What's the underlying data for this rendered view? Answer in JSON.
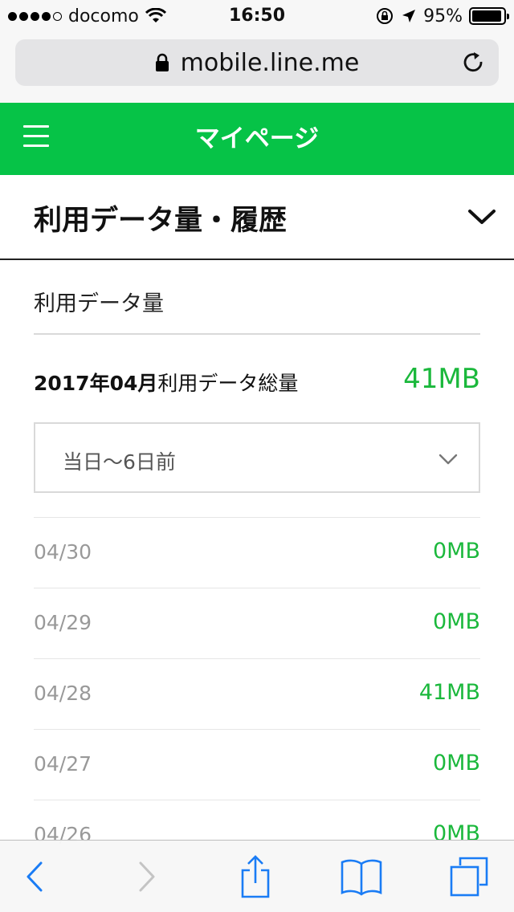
{
  "status_bar": {
    "carrier": "docomo",
    "time": "16:50",
    "battery_percent": "95%",
    "battery_level": 0.95,
    "signal_bars_filled": 4,
    "signal_bars_total": 5
  },
  "browser": {
    "url": "mobile.line.me"
  },
  "header": {
    "title": "マイページ",
    "accent_color": "#06c347"
  },
  "section": {
    "title": "利用データ量・履歴"
  },
  "usage": {
    "subtitle": "利用データ量",
    "total_month": "2017年04月",
    "total_label": "利用データ総量",
    "total_value": "41MB",
    "period_select": "当日〜6日前",
    "value_color": "#1bb83c",
    "daily": [
      {
        "date": "04/30",
        "value": "0MB"
      },
      {
        "date": "04/29",
        "value": "0MB"
      },
      {
        "date": "04/28",
        "value": "41MB"
      },
      {
        "date": "04/27",
        "value": "0MB"
      },
      {
        "date": "04/26",
        "value": "0MB"
      }
    ]
  },
  "toolbar": {
    "icons": [
      "back-icon",
      "forward-icon",
      "share-icon",
      "bookmarks-icon",
      "tabs-icon"
    ]
  }
}
